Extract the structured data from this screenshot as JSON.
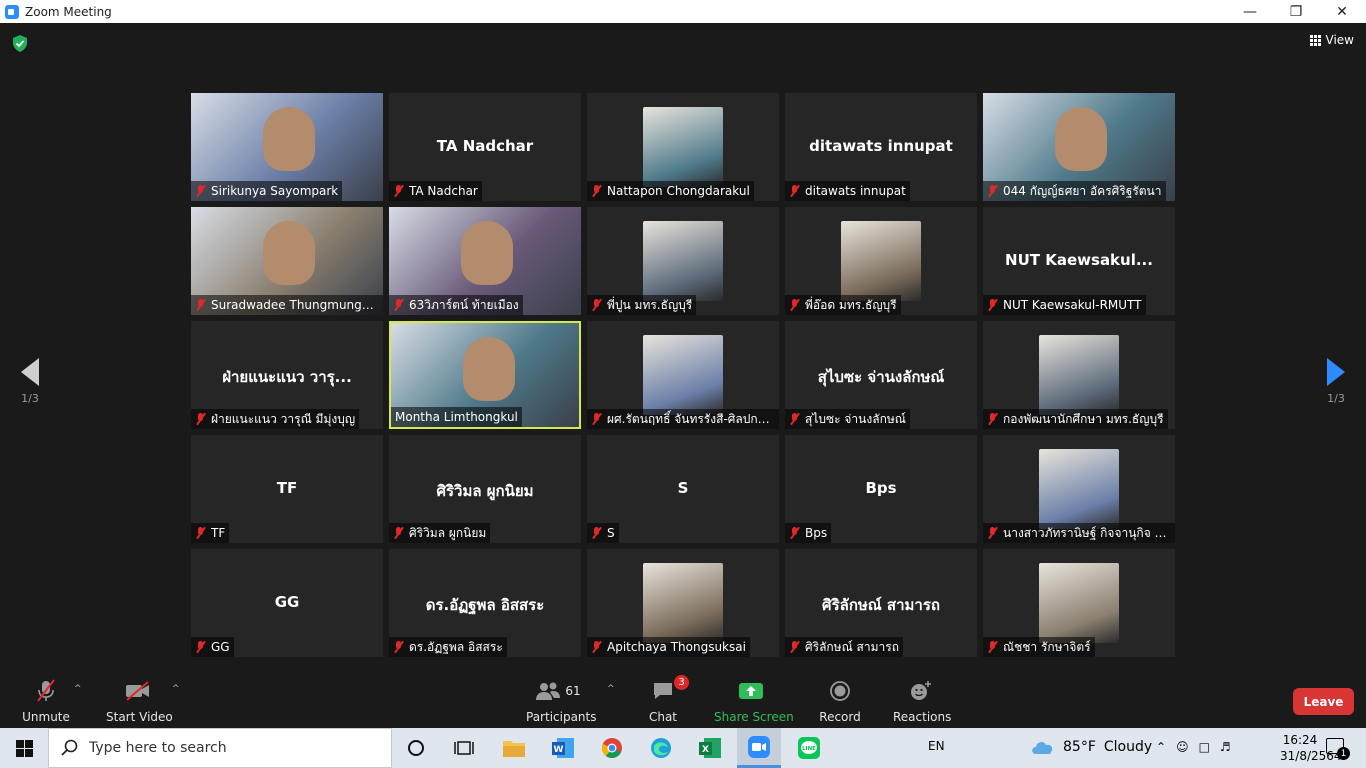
{
  "window": {
    "title": "Zoom Meeting"
  },
  "view": {
    "label": "View"
  },
  "pagination": {
    "left_page": "1/3",
    "right_page": "1/3"
  },
  "tiles": [
    {
      "big": "",
      "label": "Sirikunya Sayompark",
      "kind": "video"
    },
    {
      "big": "TA Nadchar",
      "label": "TA Nadchar",
      "kind": "name"
    },
    {
      "big": "",
      "label": "Nattapon Chongdarakul",
      "kind": "avatar"
    },
    {
      "big": "ditawats innupat",
      "label": "ditawats innupat",
      "kind": "name"
    },
    {
      "big": "",
      "label": "044 กัญญ์ธศยา อัครศิริฐรัตนา",
      "kind": "video"
    },
    {
      "big": "",
      "label": "Suradwadee Thungmungm...",
      "kind": "video"
    },
    {
      "big": "",
      "label": "63วิภาร์ตน์ ท้ายเมือง",
      "kind": "video"
    },
    {
      "big": "",
      "label": "พี่ปูน มทร.ธัญบุรี",
      "kind": "avatar"
    },
    {
      "big": "",
      "label": "พี่อ๊อด มทร.ธัญบุรี",
      "kind": "avatar"
    },
    {
      "big": "NUT  Kaewsakul...",
      "label": "NUT Kaewsakul-RMUTT",
      "kind": "name"
    },
    {
      "big": "ฝ่ายแนะแนว วารุ...",
      "label": "ฝ่ายแนะแนว วารุณี มีมุ่งบุญ",
      "kind": "name"
    },
    {
      "big": "",
      "label": "Montha Limthongkul",
      "kind": "video",
      "active": true
    },
    {
      "big": "",
      "label": "ผศ.รัตนฤทธิ์ จันทรรังสี-ศิลปกรร...",
      "kind": "avatar"
    },
    {
      "big": "สุไบซะ จ่านงลักษณ์",
      "label": "สุไบซะ จ่านงลักษณ์",
      "kind": "name"
    },
    {
      "big": "",
      "label": "กองพัฒนานักศึกษา มทร.ธัญบุรี",
      "kind": "avatar"
    },
    {
      "big": "TF",
      "label": "TF",
      "kind": "name"
    },
    {
      "big": "ศิริวิมล ผูกนิยม",
      "label": "ศิริวิมล ผูกนิยม",
      "kind": "name"
    },
    {
      "big": "S",
      "label": "S",
      "kind": "name"
    },
    {
      "big": "Bps",
      "label": "Bps",
      "kind": "name"
    },
    {
      "big": "",
      "label": "นางสาวภัทรานิษฐ์ กิจจานุกิจ โร...",
      "kind": "avatar"
    },
    {
      "big": "GG",
      "label": "GG",
      "kind": "name"
    },
    {
      "big": "ดร.อัฏฐพล อิสสระ",
      "label": "ดร.อัฏฐพล อิสสระ",
      "kind": "name"
    },
    {
      "big": "",
      "label": "Apitchaya Thongsuksai",
      "kind": "avatar"
    },
    {
      "big": "ศิริลักษณ์ สามารถ",
      "label": "ศิริลักษณ์ สามารถ",
      "kind": "name"
    },
    {
      "big": "",
      "label": "ณัชชา รักษาจิตร์",
      "kind": "avatar"
    }
  ],
  "toolbar": {
    "unmute": "Unmute",
    "start_video": "Start Video",
    "participants": "Participants",
    "participants_count": "61",
    "chat": "Chat",
    "chat_badge": "3",
    "share": "Share Screen",
    "record": "Record",
    "reactions": "Reactions",
    "leave": "Leave"
  },
  "taskbar": {
    "search_placeholder": "Type here to search",
    "lang": "EN",
    "temp": "85°F",
    "weather": "Cloudy",
    "time": "16:24",
    "date": "31/8/2564",
    "notif_count": "1"
  },
  "colors": {
    "accent": "#2d8cff",
    "active_border": "#d6e94a",
    "leave": "#d93535",
    "share": "#2ebd59"
  }
}
